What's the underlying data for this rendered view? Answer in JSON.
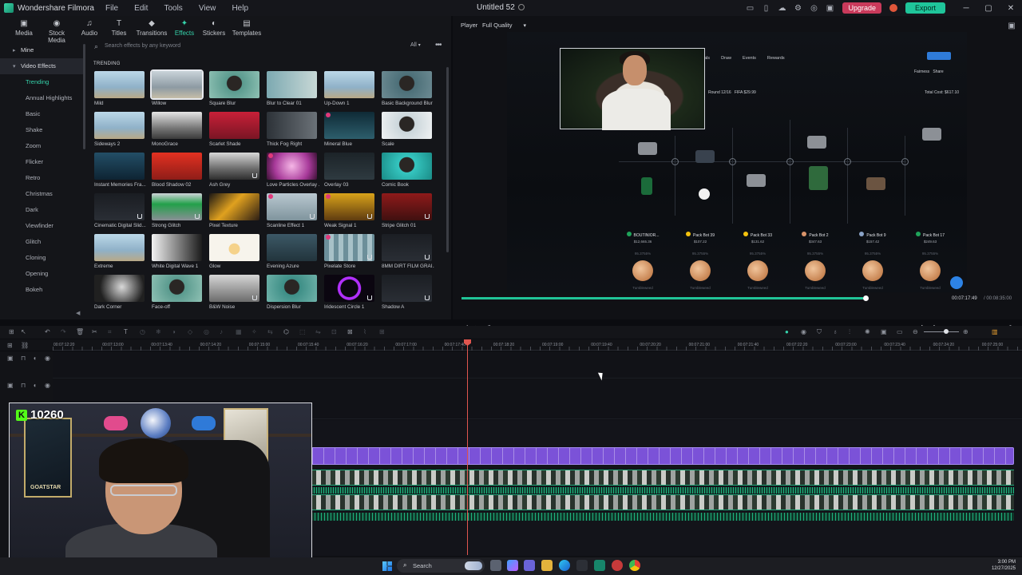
{
  "titlebar": {
    "app_name": "Wondershare Filmora",
    "menu": [
      "File",
      "Edit",
      "Tools",
      "View",
      "Help"
    ],
    "project_title": "Untitled 52",
    "upgrade_label": "Upgrade",
    "export_label": "Export"
  },
  "library": {
    "tabs": [
      {
        "label": "Media",
        "icon": "media-icon"
      },
      {
        "label": "Stock Media",
        "icon": "stock-media-icon"
      },
      {
        "label": "Audio",
        "icon": "audio-icon"
      },
      {
        "label": "Titles",
        "icon": "titles-icon"
      },
      {
        "label": "Transitions",
        "icon": "transitions-icon"
      },
      {
        "label": "Effects",
        "icon": "effects-icon"
      },
      {
        "label": "Stickers",
        "icon": "stickers-icon"
      },
      {
        "label": "Templates",
        "icon": "templates-icon"
      }
    ],
    "active_tab": "Effects",
    "sidebar": {
      "mine": "Mine",
      "video_effects": "Video Effects",
      "items": [
        "Trending",
        "Annual Highlights",
        "Basic",
        "Shake",
        "Zoom",
        "Flicker",
        "Retro",
        "Christmas",
        "Dark",
        "Viewfinder",
        "Glitch",
        "Cloning",
        "Opening",
        "Bokeh"
      ]
    },
    "search_placeholder": "Search effects by any keyword",
    "filter_label": "All",
    "section_title": "TRENDING",
    "effects": [
      "Mild",
      "Willow",
      "Square Blur",
      "Blur to Clear 01",
      "Up-Down 1",
      "Basic Background Blur",
      "Sideways 2",
      "MonoGrace",
      "Scarlet Shade",
      "Thick Fog Right",
      "Mineral Blue",
      "Scale",
      "Instant Memories Fra...",
      "Blood Shadow 02",
      "Ash Grey",
      "Love Particles Overlay ...",
      "Overlay 03",
      "Comic Book",
      "Cinematic Digital Slid...",
      "Strong Glitch",
      "Pixel Texture",
      "Scanline Effect 1",
      "Weak Signal 1",
      "Stripe Glitch 01",
      "Extreme",
      "White Digital Wave 1",
      "Glow",
      "Evening Azure",
      "Pixelate Store",
      "8MM DIRT FILM GRAI...",
      "Dark Corner",
      "Face-off",
      "B&W Noise",
      "Dispersion Blur",
      "Iridescent Circle 1",
      "Shadow A"
    ]
  },
  "player": {
    "label": "Player",
    "quality": "Full Quality",
    "time_current": "00:07:17:49",
    "time_total": "/ 00:08:35:00",
    "progress": 0.99,
    "video": {
      "nav": [
        "Deals",
        "Draw",
        "Events",
        "Rewards"
      ],
      "fairness": "Fairness",
      "share": "Share",
      "round": "Round 12/16",
      "fifa": "FIFA",
      "fifa_price": "$29.99",
      "total_cost": "Total Cost: $617.10",
      "prize_label": "$1.00",
      "packs": [
        {
          "name": "BOUTINIOR...",
          "value": "$12,665.36"
        },
        {
          "name": "Pack Bot 39",
          "value": "$107.22"
        },
        {
          "name": "Pack Bot 33",
          "value": "$131.62"
        },
        {
          "name": "Pack Bot 2",
          "value": "$347.63"
        },
        {
          "name": "Pack Bot 9",
          "value": "$157.42"
        },
        {
          "name": "Pack Bot 17",
          "value": "$249.63"
        }
      ],
      "pct": "95.3755%",
      "tumble": "Tumbleweed"
    }
  },
  "timeline": {
    "ruler": [
      "00:07:12:20",
      "00:07:13:00",
      "00:07:13:40",
      "00:07:14:20",
      "00:07:15:00",
      "00:07:15:40",
      "00:07:16:20",
      "00:07:17:00",
      "00:07:17:40",
      "00:07:18:20",
      "00:07:19:00",
      "00:07:19:40",
      "00:07:20:20",
      "00:07:21:00",
      "00:07:21:40",
      "00:07:22:20",
      "00:07:23:00",
      "00:07:23:40",
      "00:07:24:20",
      "00:07:25:00"
    ]
  },
  "webcam": {
    "kick_count": "10260",
    "kick_letter": "K",
    "card_text": "GOATSTAR"
  },
  "taskbar": {
    "search": "Search",
    "time": "3:00 PM",
    "date": "12/27/2025"
  },
  "colors": {
    "accent": "#35d3ab",
    "export": "#1fc59a",
    "upgrade": "#c93a5b",
    "playhead": "#e0564f",
    "clip_purple": "#7b52d8"
  }
}
